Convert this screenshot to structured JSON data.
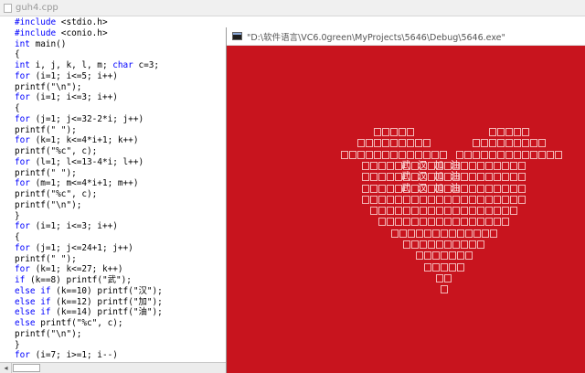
{
  "editor": {
    "tab_title": "guh4.cpp",
    "code_lines": [
      "#include <stdio.h>",
      "#include <conio.h>",
      "int main()",
      "{",
      "int i, j, k, l, m; char c=3;",
      "for (i=1; i<=5; i++)",
      "printf(\"\\n\");",
      "for (i=1; i<=3; i++)",
      "{",
      "for (j=1; j<=32-2*i; j++)",
      "printf(\" \");",
      "for (k=1; k<=4*i+1; k++)",
      "printf(\"%c\", c);",
      "for (l=1; l<=13-4*i; l++)",
      "printf(\" \");",
      "for (m=1; m<=4*i+1; m++)",
      "printf(\"%c\", c);",
      "printf(\"\\n\");",
      "}",
      "for (i=1; i<=3; i++)",
      "{",
      "for (j=1; j<=24+1; j++)",
      "printf(\" \");",
      "for (k=1; k<=27; k++)",
      "if (k==8) printf(\"武\");",
      "else if (k==10) printf(\"汉\");",
      "else if (k==12) printf(\"加\");",
      "else if (k==14) printf(\"油\");",
      "else printf(\"%c\", c);",
      "printf(\"\\n\");",
      "}",
      "for (i=7; i>=1; i--)"
    ],
    "scroll_left_arrow": "◂"
  },
  "console": {
    "title": "\"D:\\软件语言\\VC6.0green\\MyProjects\\5646\\Debug\\5646.exe\"",
    "heart_chars": [
      "武",
      "汉",
      "加",
      "油"
    ],
    "colors": {
      "background": "#c8141e",
      "box_outline": "#f3b7b7"
    }
  }
}
